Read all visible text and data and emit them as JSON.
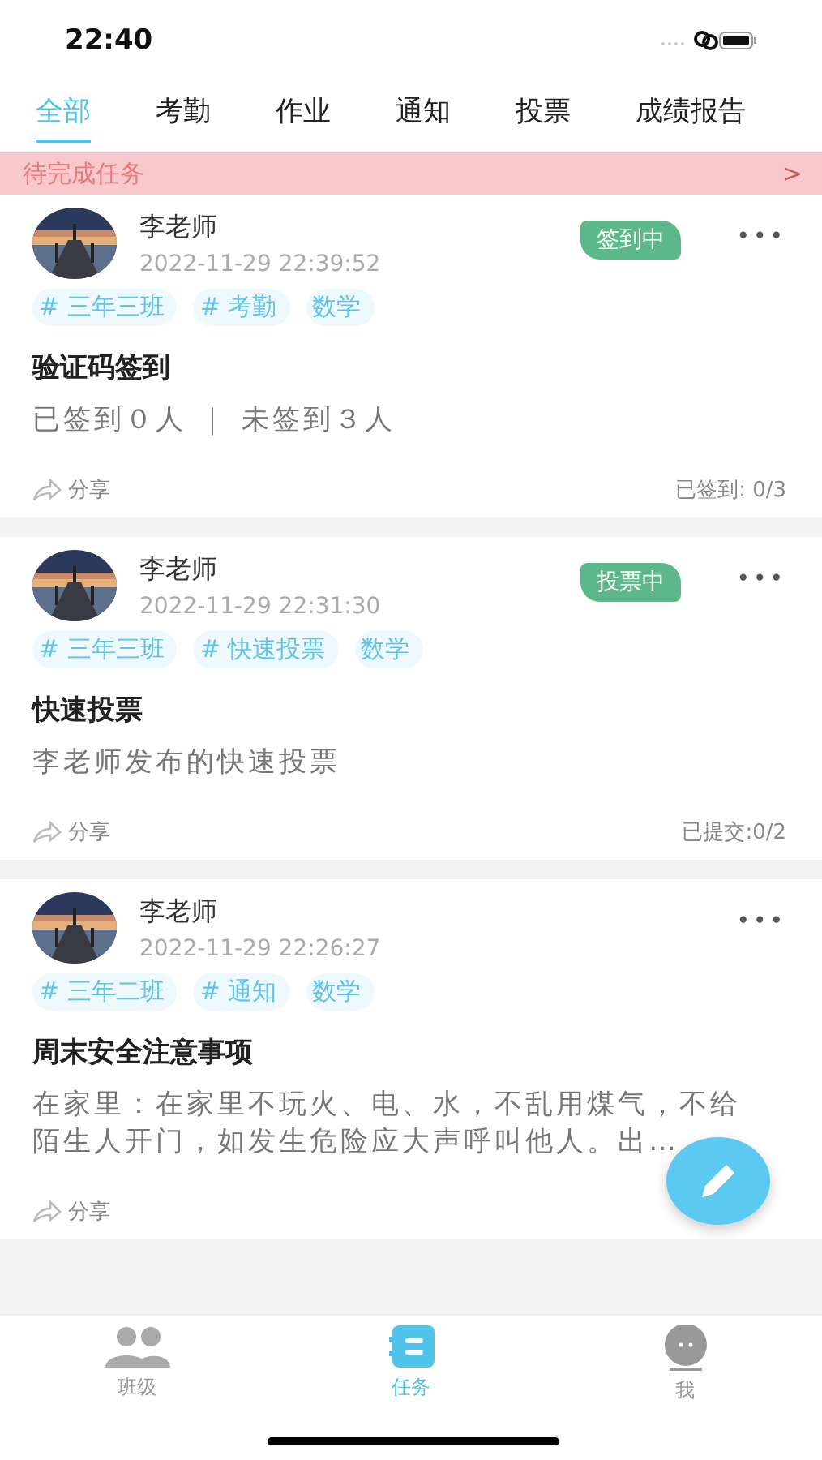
{
  "status_bar": {
    "time": "22:40"
  },
  "tabs": [
    {
      "label": "全部",
      "selected": true
    },
    {
      "label": "考勤",
      "selected": false
    },
    {
      "label": "作业",
      "selected": false
    },
    {
      "label": "通知",
      "selected": false
    },
    {
      "label": "投票",
      "selected": false
    },
    {
      "label": "成绩报告",
      "selected": false
    }
  ],
  "banner": {
    "label": "待完成任务",
    "arrow": ">"
  },
  "posts": [
    {
      "author": "李老师",
      "time": "2022-11-29 22:39:52",
      "badge": "签到中",
      "tags": [
        "# 三年三班",
        "# 考勤",
        "数学"
      ],
      "title": "验证码签到",
      "body": "已签到０人 ｜ 未签到３人",
      "share": "分享",
      "stat": "已签到: 0/3",
      "more": "•••"
    },
    {
      "author": "李老师",
      "time": "2022-11-29 22:31:30",
      "badge": "投票中",
      "tags": [
        "# 三年三班",
        "# 快速投票",
        "数学"
      ],
      "title": "快速投票",
      "body": "李老师发布的快速投票",
      "share": "分享",
      "stat": "已提交:0/2",
      "more": "•••"
    },
    {
      "author": "李老师",
      "time": "2022-11-29 22:26:27",
      "tags": [
        "# 三年二班",
        "# 通知",
        "数学"
      ],
      "title": "周末安全注意事项",
      "body": "在家里：在家里不玩火、电、水，不乱用煤气，不给陌生人开门，如发生危险应大声呼叫他人。出…",
      "share": "分享",
      "more": "•••"
    }
  ],
  "nav": [
    {
      "label": "班级",
      "kind": "people",
      "selected": false
    },
    {
      "label": "任务",
      "kind": "tasks",
      "selected": true
    },
    {
      "label": "我",
      "kind": "me",
      "selected": false
    }
  ]
}
